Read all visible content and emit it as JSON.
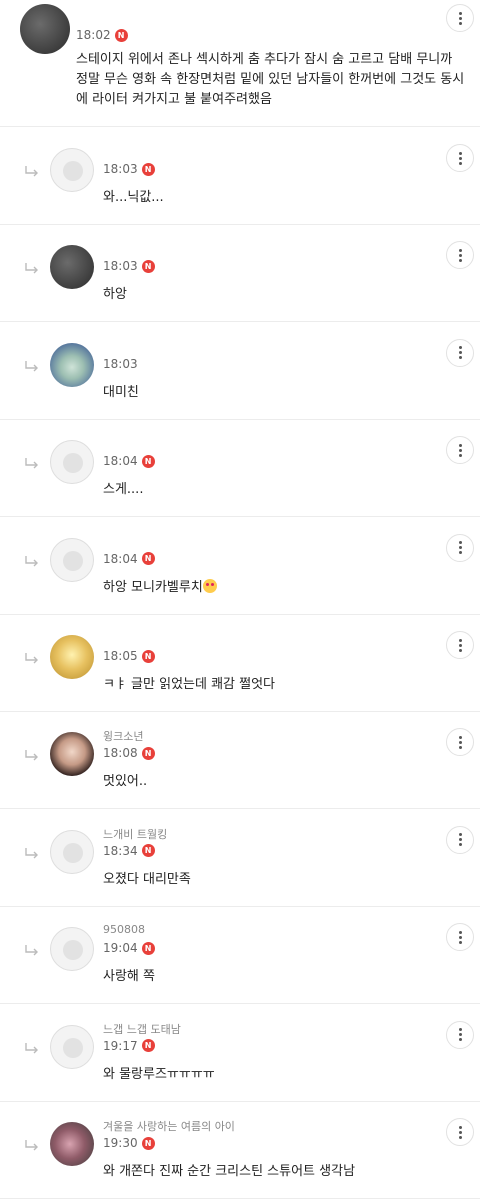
{
  "main_comment": {
    "name": "",
    "time": "18:02",
    "badge": "N",
    "text": "스테이지 위에서 존나 섹시하게 춤 추다가 잠시 숨 고르고 담배 무니까 정말 무슨 영화 속 한장면처럼 밑에 있던 남자들이 한꺼번에 그것도 동시에 라이터 켜가지고 불 붙여주려했음"
  },
  "replies": [
    {
      "name": "",
      "time": "18:03",
      "badge": "N",
      "text": "와...닉값..."
    },
    {
      "name": "",
      "time": "18:03",
      "badge": "N",
      "text": "하앙"
    },
    {
      "name": "",
      "time": "18:03",
      "badge": "",
      "text": "대미친"
    },
    {
      "name": "",
      "time": "18:04",
      "badge": "N",
      "text": "스게...."
    },
    {
      "name": "",
      "time": "18:04",
      "badge": "N",
      "text": "하앙 모니카벨루치"
    },
    {
      "name": "",
      "time": "18:05",
      "badge": "N",
      "text": "ㅋㅑ 글만 읽었는데 쾌감 쩔엇다"
    },
    {
      "name": "윙크소년",
      "time": "18:08",
      "badge": "N",
      "text": "멋있어.."
    },
    {
      "name": "느개비 트월킹",
      "time": "18:34",
      "badge": "N",
      "text": "오졌다 대리만족"
    },
    {
      "name": "950808",
      "time": "19:04",
      "badge": "N",
      "text": "사랑해 쪽"
    },
    {
      "name": "느갭 느갭 도태남",
      "time": "19:17",
      "badge": "N",
      "text": "와 물랑루즈ㅠㅠㅠㅠ"
    },
    {
      "name": "겨울을 사랑하는 여름의 아이",
      "time": "19:30",
      "badge": "N",
      "text": "와 개쫀다 진짜 순간 크리스틴 스튜어트 생각남"
    }
  ],
  "icons": {
    "more": "more-vertical-icon",
    "reply": "reply-arrow-icon",
    "badge_color": "#e8403a"
  }
}
